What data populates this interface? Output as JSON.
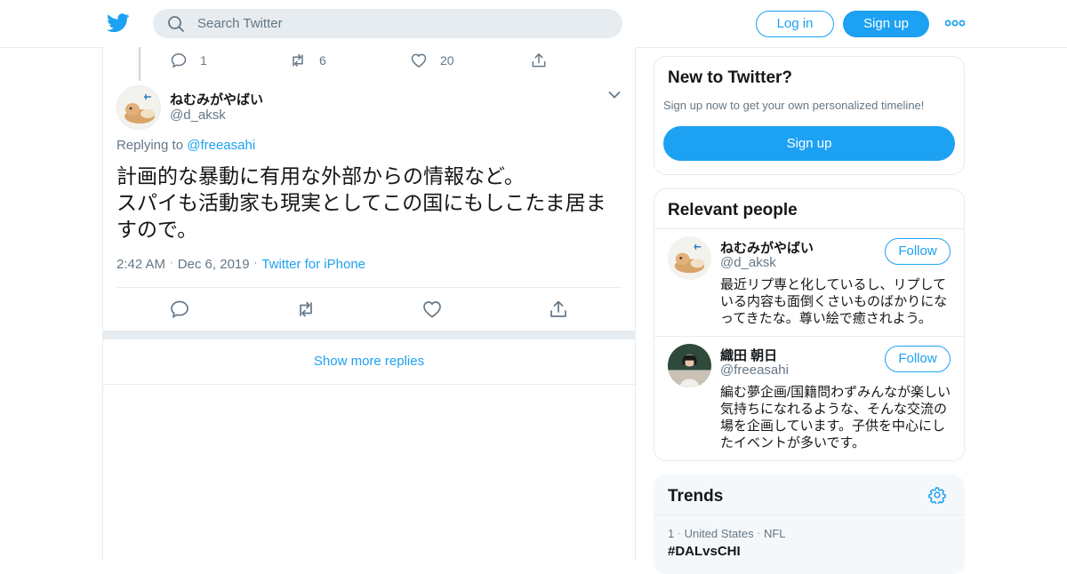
{
  "header": {
    "logo_icon": "twitter-bird-icon",
    "search_placeholder": "Search Twitter",
    "login_label": "Log in",
    "signup_label": "Sign up",
    "more_icon": "more-dots-icon"
  },
  "thread_prev_actions": {
    "reply_count": "1",
    "retweet_count": "6",
    "like_count": "20"
  },
  "tweet": {
    "author_name": "ねむみがやばい",
    "author_handle": "@d_aksk",
    "replying_prefix": "Replying to ",
    "replying_handle": "@freeasahi",
    "text_line1": "計画的な暴動に有用な外部からの情報など。",
    "text_line2": "スパイも活動家も現実としてこの国にもしこたま居ますので。",
    "time": "2:42 AM",
    "date": "Dec 6, 2019",
    "source": "Twitter for iPhone"
  },
  "show_more_replies": "Show more replies",
  "new_to_twitter": {
    "title": "New to Twitter?",
    "subtitle": "Sign up now to get your own personalized timeline!",
    "signup_label": "Sign up"
  },
  "relevant_people": {
    "title": "Relevant people",
    "people": [
      {
        "name": "ねむみがやばい",
        "handle": "@d_aksk",
        "bio": "最近リプ専と化しているし、リプしている内容も面倒くさいものばかりになってきたな。尊い絵で癒されよう。",
        "follow_label": "Follow"
      },
      {
        "name": "織田 朝日",
        "handle": "@freeasahi",
        "bio": "編む夢企画/国籍問わずみんなが楽しい気持ちになれるような、そんな交流の場を企画しています。子供を中心にしたイベントが多いです。",
        "follow_label": "Follow"
      }
    ]
  },
  "trends": {
    "title": "Trends",
    "items": [
      {
        "rank": "1",
        "location": "United States",
        "category": "NFL",
        "tag": "#DALvsCHI"
      }
    ]
  },
  "colors": {
    "accent": "#1da1f2",
    "secondary_text": "#657786",
    "border": "#e6ecf0"
  }
}
